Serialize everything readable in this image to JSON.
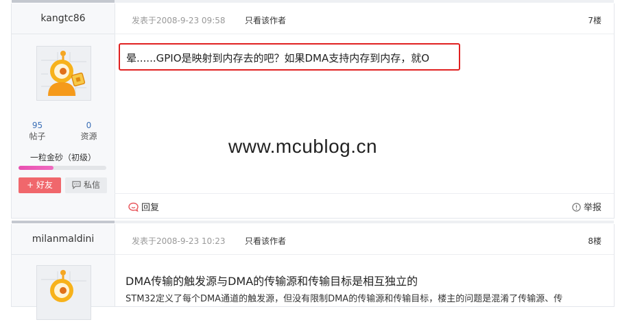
{
  "posts": [
    {
      "author": "kangtc86",
      "posted_at": "发表于2008-9-23 09:58",
      "only_author_link": "只看该作者",
      "floor": "7楼",
      "content_line": "晕......GPIO是映射到内存去的吧？如果DMA支持内存到内存，就O",
      "stats": {
        "posts_count": "95",
        "posts_label": "帖子",
        "resources_count": "0",
        "resources_label": "资源"
      },
      "rank": "一粒金砂（初级）",
      "level_progress": 0.4,
      "add_friend": "+ 好友",
      "message": "私信",
      "reply": "回复",
      "report": "举报"
    },
    {
      "author": "milanmaldini",
      "posted_at": "发表于2008-9-23 10:23",
      "only_author_link": "只看该作者",
      "floor": "8楼",
      "content_title": "DMA传输的触发源与DMA的传输源和传输目标是相互独立的",
      "content_body": "STM32定义了每个DMA通道的触发源，但没有限制DMA的传输源和传输目标，楼主的问题是混淆了传输源、传"
    }
  ],
  "watermark": "www.mcublog.cn",
  "colors": {
    "highlight": "#e02020",
    "friend_button": "#f0676c",
    "level_bar": "#e74fb0",
    "stat_number": "#3b6fb6"
  }
}
